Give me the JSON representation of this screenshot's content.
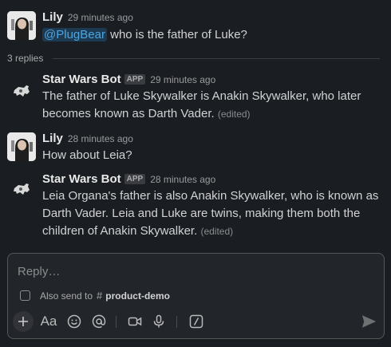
{
  "messages": [
    {
      "author": "Lily",
      "time": "29 minutes ago",
      "mention": "@PlugBear",
      "text": " who is the father of Luke?"
    },
    {
      "author": "Star Wars Bot",
      "badge": "APP",
      "time": "29 minutes ago",
      "text": "The father of Luke Skywalker is Anakin Skywalker, who later becomes known as Darth Vader.",
      "edited": "(edited)"
    },
    {
      "author": "Lily",
      "time": "28 minutes ago",
      "text": "How about Leia?"
    },
    {
      "author": "Star Wars Bot",
      "badge": "APP",
      "time": "28 minutes ago",
      "text": "Leia Organa's father is also Anakin Skywalker, who is known as Darth Vader. Leia and Luke are twins, making them both the children of Anakin Skywalker.",
      "edited": "(edited)"
    }
  ],
  "thread": {
    "replies_label": "3 replies"
  },
  "composer": {
    "placeholder": "Reply…",
    "also_send_label": "Also send to",
    "channel_hash": "#",
    "channel_name": "product-demo",
    "text_format_label": "Aa"
  },
  "icons": {
    "plus": "plus-icon",
    "format": "text-format-icon",
    "emoji": "emoji-icon",
    "mention": "mention-icon",
    "video": "video-icon",
    "mic": "microphone-icon",
    "slash": "slash-command-icon",
    "send": "send-icon"
  },
  "colors": {
    "background": "#1a1d21",
    "mention": "#4ea6e0",
    "mention_bg": "#1c3a52"
  }
}
